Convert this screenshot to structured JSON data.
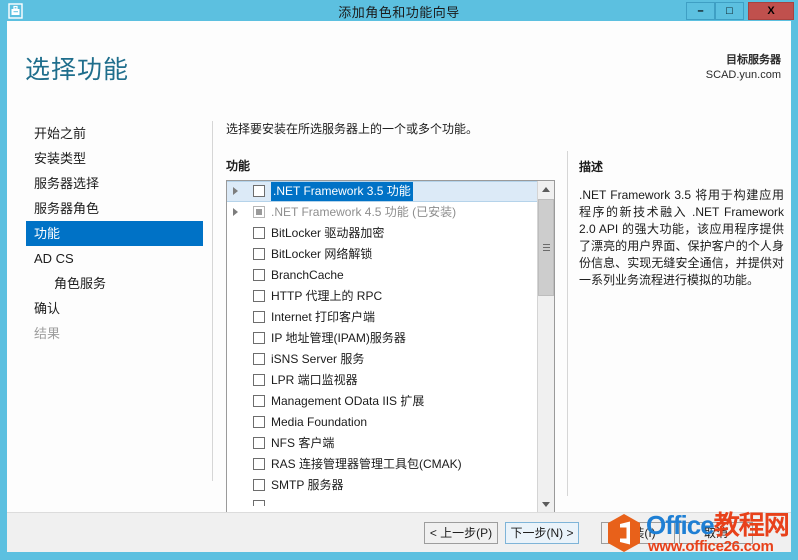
{
  "window": {
    "title": "添加角色和功能向导",
    "icon": "server-manager-icon",
    "controls": {
      "minimize": "–",
      "maximize": "□",
      "close": "X"
    },
    "colors": {
      "titlebar": "#5cc0e0",
      "accent": "#0072c6",
      "heading": "#1f6e8c",
      "close_button": "#c0504d"
    }
  },
  "header": {
    "page_title": "选择功能",
    "destination_label": "目标服务器",
    "destination_value": "SCAD.yun.com"
  },
  "sidebar": {
    "items": [
      {
        "label": "开始之前",
        "state": "normal",
        "indent": false
      },
      {
        "label": "安装类型",
        "state": "normal",
        "indent": false
      },
      {
        "label": "服务器选择",
        "state": "normal",
        "indent": false
      },
      {
        "label": "服务器角色",
        "state": "normal",
        "indent": false
      },
      {
        "label": "功能",
        "state": "selected",
        "indent": false
      },
      {
        "label": "AD CS",
        "state": "normal",
        "indent": false
      },
      {
        "label": "角色服务",
        "state": "normal",
        "indent": true
      },
      {
        "label": "确认",
        "state": "normal",
        "indent": false
      },
      {
        "label": "结果",
        "state": "disabled",
        "indent": false
      }
    ]
  },
  "main": {
    "instruction": "选择要安装在所选服务器上的一个或多个功能。",
    "group_label": "功能",
    "features": [
      {
        "label": ".NET Framework 3.5 功能",
        "checked": false,
        "installed": false,
        "expandable": true,
        "selected": true
      },
      {
        "label": ".NET Framework 4.5 功能 (已安装)",
        "checked": true,
        "installed": true,
        "expandable": true,
        "selected": false
      },
      {
        "label": "BitLocker 驱动器加密",
        "checked": false,
        "installed": false,
        "expandable": false,
        "selected": false
      },
      {
        "label": "BitLocker 网络解锁",
        "checked": false,
        "installed": false,
        "expandable": false,
        "selected": false
      },
      {
        "label": "BranchCache",
        "checked": false,
        "installed": false,
        "expandable": false,
        "selected": false
      },
      {
        "label": "HTTP 代理上的 RPC",
        "checked": false,
        "installed": false,
        "expandable": false,
        "selected": false
      },
      {
        "label": "Internet 打印客户端",
        "checked": false,
        "installed": false,
        "expandable": false,
        "selected": false
      },
      {
        "label": "IP 地址管理(IPAM)服务器",
        "checked": false,
        "installed": false,
        "expandable": false,
        "selected": false
      },
      {
        "label": "iSNS Server 服务",
        "checked": false,
        "installed": false,
        "expandable": false,
        "selected": false
      },
      {
        "label": "LPR 端口监视器",
        "checked": false,
        "installed": false,
        "expandable": false,
        "selected": false
      },
      {
        "label": "Management OData IIS 扩展",
        "checked": false,
        "installed": false,
        "expandable": false,
        "selected": false
      },
      {
        "label": "Media Foundation",
        "checked": false,
        "installed": false,
        "expandable": false,
        "selected": false
      },
      {
        "label": "NFS 客户端",
        "checked": false,
        "installed": false,
        "expandable": false,
        "selected": false
      },
      {
        "label": "RAS 连接管理器管理工具包(CMAK)",
        "checked": false,
        "installed": false,
        "expandable": false,
        "selected": false
      },
      {
        "label": "SMTP 服务器",
        "checked": false,
        "installed": false,
        "expandable": false,
        "selected": false
      }
    ]
  },
  "description": {
    "title": "描述",
    "body": ".NET Framework 3.5 将用于构建应用程序的新技术融入 .NET Framework 2.0 API 的强大功能，该应用程序提供了漂亮的用户界面、保护客户的个人身份信息、实现无缝安全通信，并提供对一系列业务流程进行模拟的功能。"
  },
  "footer": {
    "previous": "< 上一步(P)",
    "next": "下一步(N) >",
    "install": "安装(I)",
    "cancel": "取消"
  },
  "watermark": {
    "brand_blue": "Office",
    "brand_red": "教程网",
    "url": "www.office26.com",
    "logo_color": "#e8611a"
  }
}
